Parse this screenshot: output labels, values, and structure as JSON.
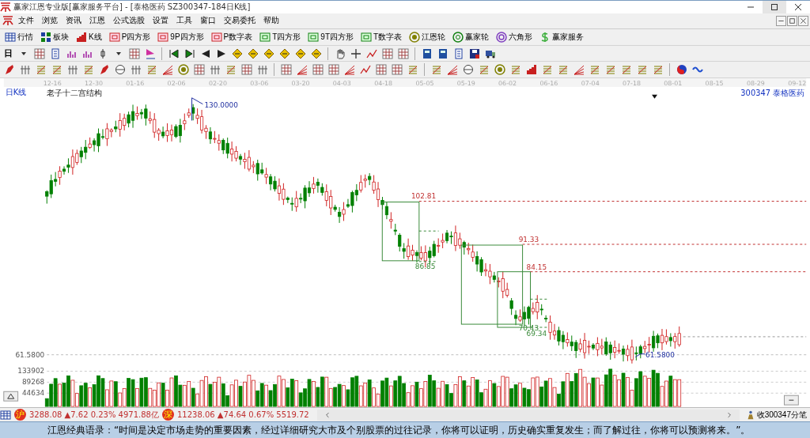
{
  "window": {
    "title": "赢家江恩专业版[赢家服务平台] - [泰格医药  SZ300347-184日K线]"
  },
  "menu": [
    "文件",
    "浏览",
    "资讯",
    "江恩",
    "公式选股",
    "设置",
    "工具",
    "窗口",
    "交易委托",
    "帮助"
  ],
  "toolbar": [
    "行情",
    "板块",
    "K线",
    "P四方形",
    "9P四方形",
    "P数字表",
    "T四方形",
    "9T四方形",
    "T数字表",
    "江恩轮",
    "赢家轮",
    "六角形",
    "赢家服务"
  ],
  "period_button": "日",
  "chart": {
    "period_label": "日K线",
    "study_title": "老子十二宫结构",
    "code": "300347",
    "name": "泰格医药",
    "dates": [
      "12-16",
      "12-30",
      "01-16",
      "02-06",
      "02-20",
      "03-06",
      "03-20",
      "04-03",
      "04-18",
      "05-05",
      "05-19",
      "06-02",
      "06-16",
      "07-04",
      "07-18",
      "08-01",
      "08-15",
      "08-29",
      "09-12"
    ],
    "high_label": "130.0000",
    "low_label": "61.5800",
    "axis_label": "61.5800",
    "levels": [
      {
        "kind": "resistance",
        "text": "102.81"
      },
      {
        "kind": "resistance",
        "text": "91.33"
      },
      {
        "kind": "resistance",
        "text": "84.15"
      },
      {
        "kind": "box",
        "text": "86.85"
      },
      {
        "kind": "box",
        "text": "70.43"
      },
      {
        "kind": "box",
        "text": "69.34"
      }
    ],
    "volume_labels": [
      "133902",
      "89268",
      "44634"
    ]
  },
  "status": {
    "indices": [
      {
        "market": "沪",
        "text": "3288.08 ▲7.62 0.23% 4971.88亿"
      },
      {
        "market": "深",
        "text": "11238.06 ▲74.64 0.67% 5519.72"
      }
    ],
    "ticks_button": "收300347分笔"
  },
  "ticker": "江恩经典语录：“时间是决定市场走势的重要因素，经过详细研究大市及个别股票的过往记录，你将可以证明，历史确实重复发生；而了解过往，你将可以预测将来。”。"
}
